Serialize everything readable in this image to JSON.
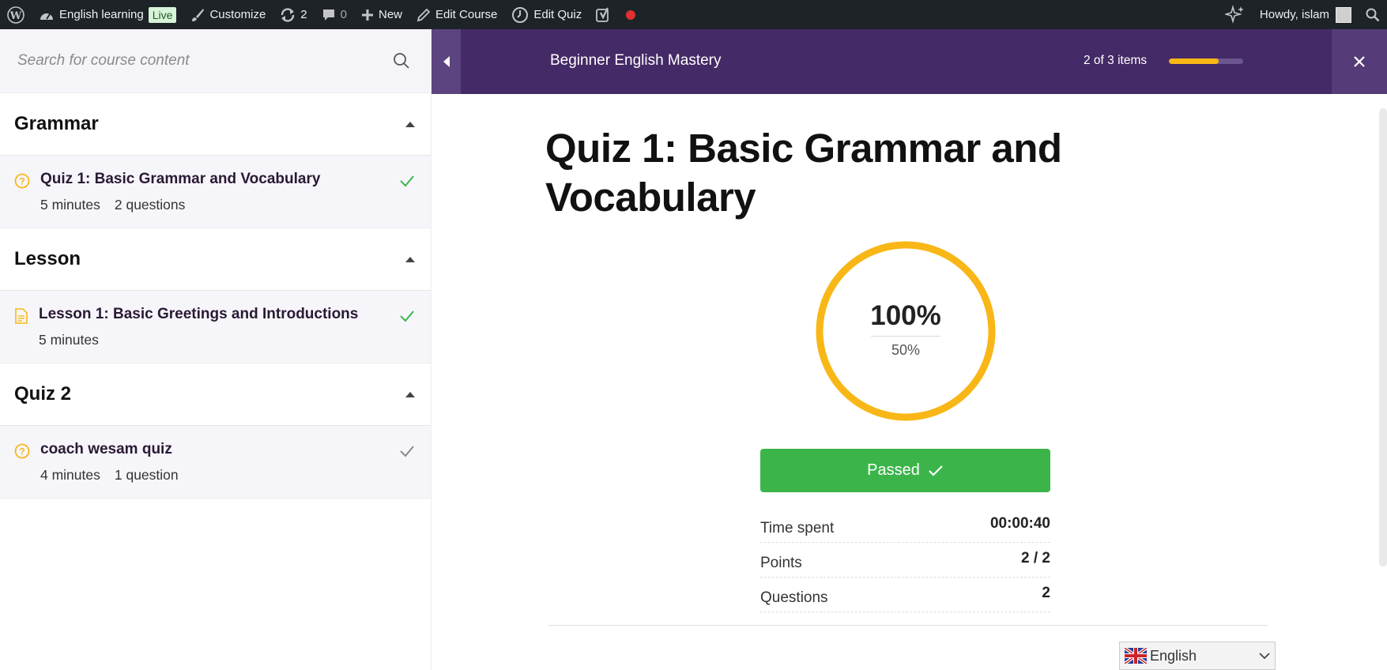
{
  "adminbar": {
    "site_name": "English learning",
    "live_badge": "Live",
    "customize": "Customize",
    "updates_count": "2",
    "comments_count": "0",
    "new_label": "New",
    "edit_course": "Edit Course",
    "edit_quiz": "Edit Quiz",
    "howdy": "Howdy, islam"
  },
  "sidebar": {
    "search_placeholder": "Search for course content",
    "sections": [
      {
        "title": "Grammar",
        "item": {
          "title": "Quiz 1: Basic Grammar and Vocabulary",
          "duration": "5 minutes",
          "questions": "2 questions",
          "type": "quiz",
          "status": "completed"
        }
      },
      {
        "title": "Lesson",
        "item": {
          "title": "Lesson 1: Basic Greetings and Introductions",
          "duration": "5 minutes",
          "type": "lesson",
          "status": "completed"
        }
      },
      {
        "title": "Quiz 2",
        "item": {
          "title": "coach wesam quiz",
          "duration": "4 minutes",
          "questions": "1 question",
          "type": "quiz",
          "status": "viewed"
        }
      }
    ]
  },
  "header": {
    "course_title": "Beginner English Mastery",
    "items_count": "2 of 3 items",
    "progress_fraction": 0.667
  },
  "quiz": {
    "title": "Quiz 1: Basic Grammar and Vocabulary",
    "result_percent": "100%",
    "passing_grade": "50%",
    "status_label": "Passed",
    "stats": [
      {
        "label": "Time spent",
        "value": "00:00:40"
      },
      {
        "label": "Points",
        "value": "2 / 2"
      },
      {
        "label": "Questions",
        "value": "2"
      }
    ]
  },
  "language_selector": {
    "selected": "English"
  },
  "colors": {
    "adminbar_bg": "#1d2327",
    "header_bg": "#442a66",
    "accent": "#f8b716",
    "success": "#3bb54a",
    "check_done": "#3bb54a",
    "check_viewed": "#8a8a8a"
  }
}
